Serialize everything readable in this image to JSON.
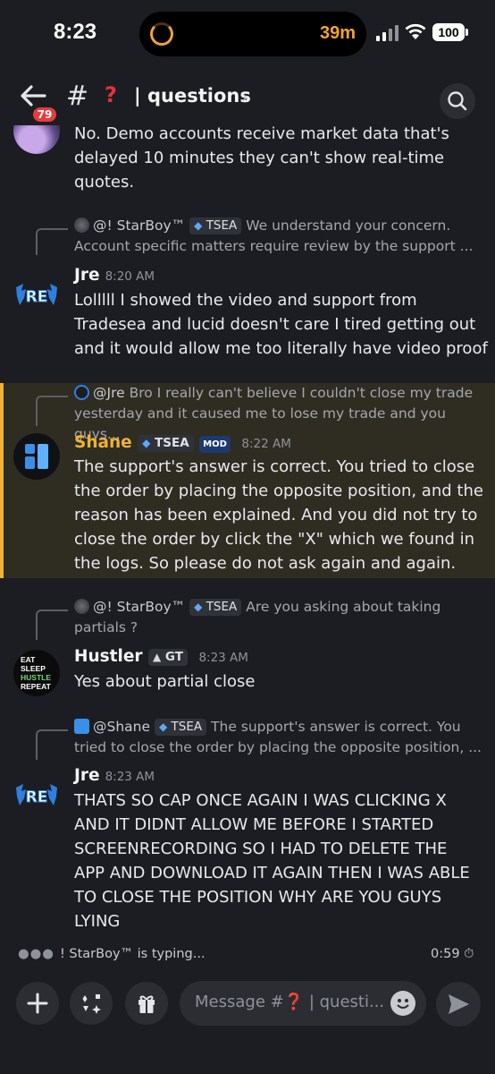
{
  "status_bar": {
    "time": "8:23",
    "timer": "39m",
    "battery": "100"
  },
  "header": {
    "unread_badge": "79",
    "channel_prefix": "| questions"
  },
  "messages": {
    "m0": {
      "lines": [
        "No. Demo  accounts receive market data that's",
        "delayed 10 minutes they can't show real-time",
        "quotes."
      ]
    },
    "m1": {
      "reply_name": "@! StarBoy™",
      "reply_tag": "TSEA",
      "reply_lines": [
        "We understand your concern.",
        "Account specific matters require review by the support ..."
      ],
      "author": "Jre",
      "time": "8:20 AM",
      "lines": [
        "Lolllll I showed the video and support from",
        "Tradesea and lucid doesn't care I tired getting out",
        "and it would allow me too literally have video proof"
      ]
    },
    "m2": {
      "reply_name": "@Jre",
      "reply_lines": [
        "Bro I really can't believe I couldn't close my trade",
        "yesterday and it caused me to lose my trade and you guys..."
      ],
      "author": "Shane",
      "tag": "TSEA",
      "mod_tag": "MOD",
      "time": "8:22 AM",
      "lines": [
        "The support's answer is correct. You tried to close",
        "the order by placing the opposite position, and the",
        "reason has been explained. And you did not try to",
        "close the order by click the \"X\" which we found in",
        "the logs. So please do not ask again and again."
      ]
    },
    "m3": {
      "reply_name": "@! StarBoy™",
      "reply_tag": "TSEA",
      "reply_lines": [
        "Are you asking about taking",
        "partials ?"
      ],
      "author": "Hustler",
      "tag": "GT",
      "time": "8:23 AM",
      "avatar_lines": [
        "EAT",
        "SLEEP",
        "HUSTLE",
        "REPEAT"
      ],
      "lines": [
        "Yes about partial close"
      ]
    },
    "m4": {
      "reply_name": "@Shane",
      "reply_tag": "TSEA",
      "reply_lines": [
        "The support's answer is correct. You",
        "tried to close the order by placing the opposite position, ..."
      ],
      "author": "Jre",
      "time": "8:23 AM",
      "lines": [
        "THATS SO CAP ONCE AGAIN I WAS CLICKING X",
        "AND IT DIDNT ALLOW ME BEFORE I STARTED",
        "SCREENRECORDING SO I HAD TO DELETE THE",
        "APP AND DOWNLOAD IT AGAIN THEN I WAS ABLE",
        "TO CLOSE THE POSITION WHY ARE YOU GUYS",
        "LYING"
      ]
    }
  },
  "typing": {
    "text": "! StarBoy™ is typing...",
    "slowmode": "0:59"
  },
  "composer": {
    "placeholder": "Message #❓ | questi..."
  },
  "icons": [
    "back-arrow-icon",
    "hash-icon",
    "question-mark-icon",
    "chevron-right-icon",
    "search-icon",
    "plus-icon",
    "apps-icon",
    "gift-icon",
    "emoji-icon",
    "send-icon",
    "stopwatch-icon"
  ],
  "colors": {
    "accent_mention": "#f0b232",
    "role_tag_icon": "#5fa8f5",
    "badge": "#e53c3c",
    "jre_logo": "#2f7fe0"
  }
}
